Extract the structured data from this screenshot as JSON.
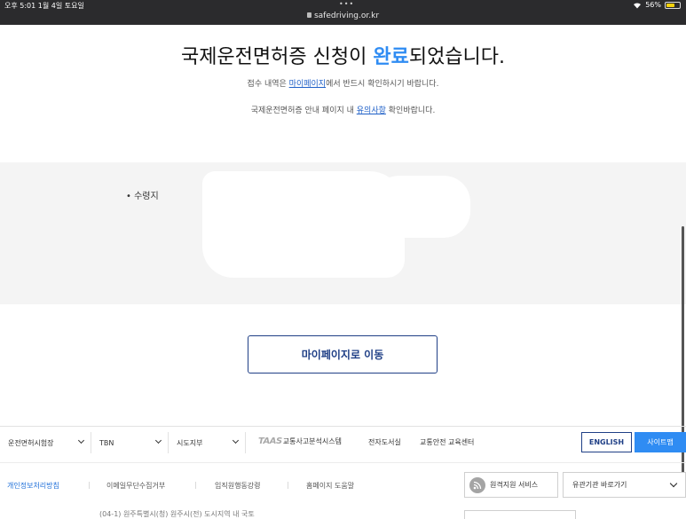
{
  "statusbar": {
    "time": "오후 5:01  1월 4일 토요일",
    "dots": "•••",
    "url": "safedriving.or.kr",
    "battery": "56%"
  },
  "completion": {
    "title_before": "국제운전면허증 신청이 ",
    "title_highlight": "완료",
    "title_after": "되었습니다.",
    "msg1_before": "접수 내역은 ",
    "msg1_link": "마이페이지",
    "msg1_after": "에서 반드시 확인하시기 바랍니다.",
    "msg2_before": "국제운전면허증 안내 페이지 내 ",
    "msg2_link": "유의사항",
    "msg2_after": " 확인바랍니다."
  },
  "info": {
    "receive_label": "• 수령지"
  },
  "main_button": {
    "label": "마이페이지로 이동"
  },
  "footer": {
    "selects": [
      "운전면허시험장",
      "TBN",
      "시도지부"
    ],
    "taas_logo": "TAAS",
    "taas_label": "교통사고분석시스템",
    "links": [
      "전자도서실",
      "교통안전 교육센터"
    ],
    "english": "ENGLISH",
    "sitemap": "사이트맵",
    "policy_links": [
      "개인정보처리방침",
      "이메일무단수집거부",
      "임직원행동강령",
      "홈페이지 도움말"
    ],
    "remote_service": "원격지원 서비스",
    "related_sites": "유관기관 바로가기",
    "cut_text": "(04-1) 원주특별시(청) 원주시(전) 도시지역 내 국토"
  },
  "colors": {
    "accent": "#2f8cf3",
    "navy": "#1f3f86",
    "grey_box": "#f4f4f4"
  },
  "icons": [
    "wifi-icon",
    "lock-icon",
    "battery-icon",
    "chevron-down-icon",
    "rss-icon"
  ]
}
